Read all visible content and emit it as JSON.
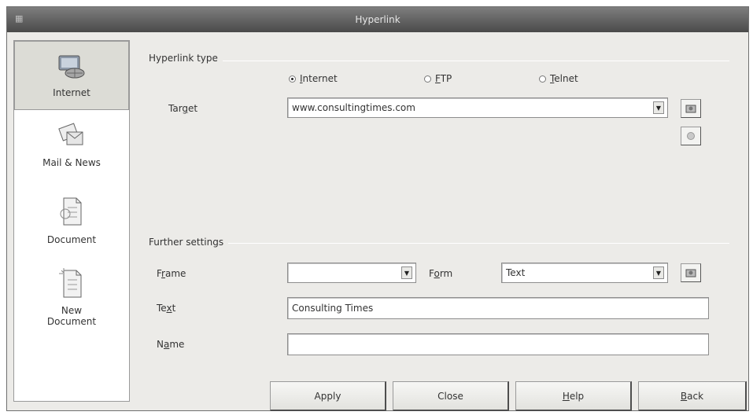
{
  "window": {
    "title": "Hyperlink"
  },
  "sidebar": {
    "items": [
      {
        "label": "Internet",
        "icon": "internet-icon",
        "selected": true
      },
      {
        "label": "Mail & News",
        "icon": "mail-news-icon",
        "selected": false
      },
      {
        "label": "Document",
        "icon": "document-icon",
        "selected": false
      },
      {
        "label": "New",
        "label2": "Document",
        "icon": "new-document-icon",
        "selected": false
      }
    ]
  },
  "hyperlink_type": {
    "title": "Hyperlink type",
    "options": [
      {
        "pre": "",
        "key": "I",
        "post": "nternet",
        "selected": true
      },
      {
        "pre": "",
        "key": "F",
        "post": "TP",
        "selected": false
      },
      {
        "pre": "",
        "key": "T",
        "post": "elnet",
        "selected": false
      }
    ],
    "target": {
      "pre": "Tar",
      "key": "g",
      "post": "et",
      "value": "www.consultingtimes.com"
    }
  },
  "further_settings": {
    "title": "Further settings",
    "frame": {
      "pre": "F",
      "key": "r",
      "post": "ame",
      "value": ""
    },
    "form": {
      "pre": "F",
      "key": "o",
      "post": "rm",
      "value": "Text"
    },
    "text": {
      "pre": "Te",
      "key": "x",
      "post": "t",
      "value": "Consulting Times"
    },
    "name": {
      "pre": "N",
      "key": "a",
      "post": "me",
      "value": ""
    }
  },
  "buttons": {
    "apply": "Apply",
    "close": "Close",
    "help": {
      "key": "H",
      "post": "elp"
    },
    "back": {
      "key": "B",
      "post": "ack"
    }
  },
  "colors": {
    "titlebar": "#5c5c5c",
    "dialog_bg": "#ecebe8",
    "selected_item": "#dcdcd6"
  }
}
